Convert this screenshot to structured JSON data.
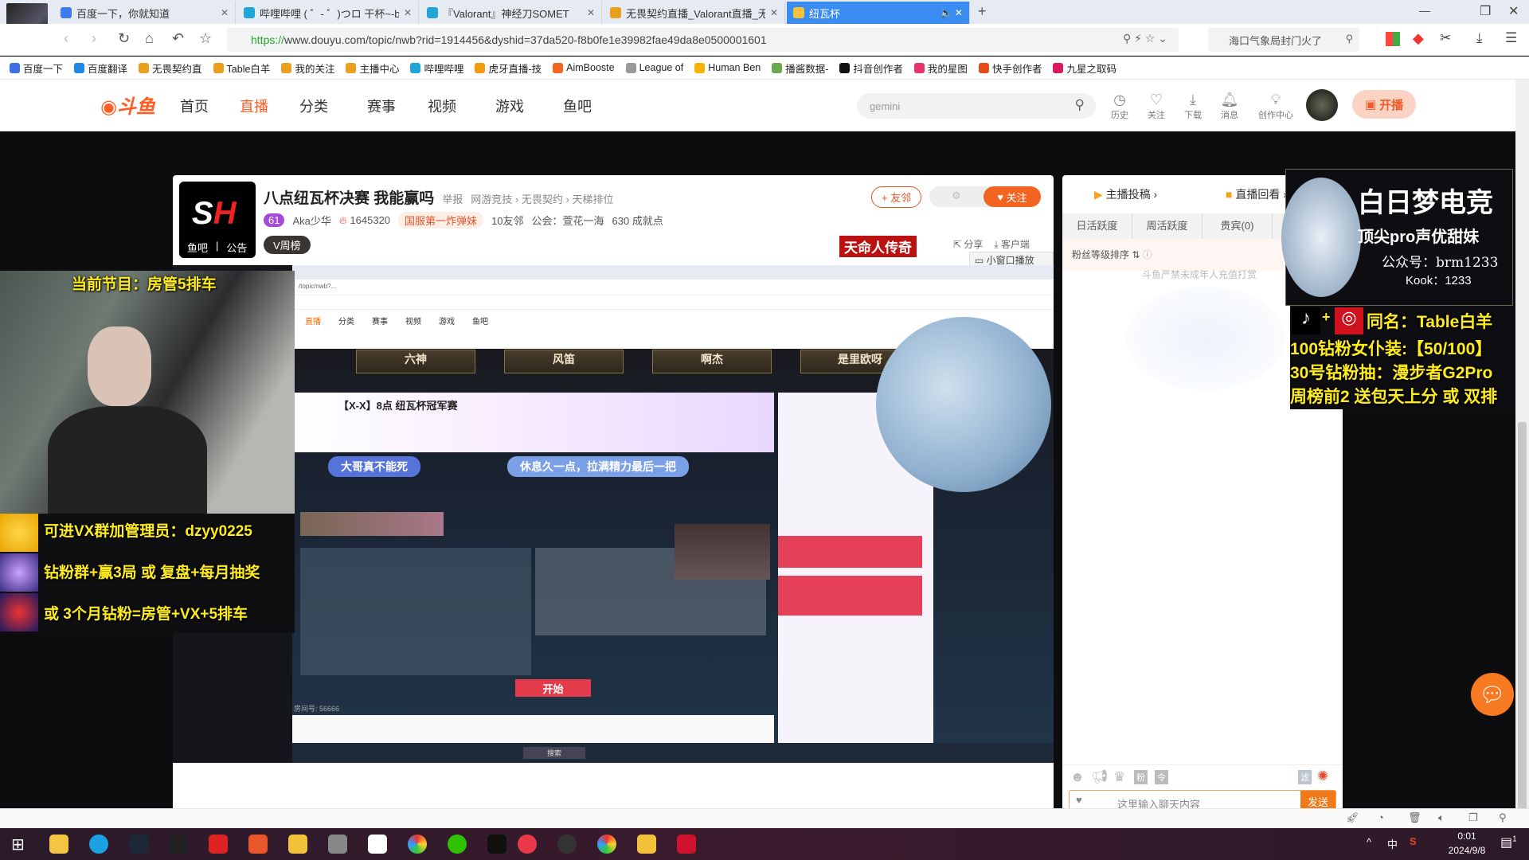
{
  "browser": {
    "tabs": [
      {
        "label": "百度一下，你就知道",
        "active": false
      },
      {
        "label": "哔哩哔哩 ( ゜- ゜)つロ 干杯~-bi",
        "active": false
      },
      {
        "label": "『Valorant』神经刀SOMET",
        "active": false
      },
      {
        "label": "无畏契约直播_Valorant直播_无",
        "active": false
      },
      {
        "label": "纽瓦杯",
        "active": true
      }
    ],
    "url_scheme": "https://",
    "url_rest": "www.douyu.com/topic/nwb?rid=1914456&dyshid=37da520-f8b0fe1e39982fae49da8e0500001601",
    "news_search": "海口气象局封门火了",
    "bookmarks": [
      "百度一下",
      "百度翻译",
      "无畏契约直",
      "Table白羊",
      "我的关注",
      "主播中心",
      "哔哩哔哩",
      "虎牙直播-技",
      "AimBooste",
      "League of",
      "Human Ben",
      "播酱数据-",
      "抖音创作者",
      "我的星图",
      "快手创作者",
      "九星之取码"
    ],
    "bookmark_colors": [
      "#3d6fe0",
      "#1e88e5",
      "#e9a01c",
      "#e9a01c",
      "#e9a01c",
      "#e9a01c",
      "#20a7d8",
      "#f39c12",
      "#f26522",
      "#999999",
      "#f4b400",
      "#6aa84f",
      "#111111",
      "#e8336b",
      "#e64a19",
      "#d81b60"
    ]
  },
  "douyu": {
    "nav": [
      "首页",
      "直播",
      "分类",
      "赛事",
      "视频",
      "游戏",
      "鱼吧"
    ],
    "active_nav": "直播",
    "search_value": "gemini",
    "header_icons": [
      {
        "icon": "history-icon",
        "label": "历史"
      },
      {
        "icon": "heart-icon",
        "label": "关注"
      },
      {
        "icon": "download-icon",
        "label": "下载"
      },
      {
        "icon": "bell-icon",
        "label": "消息"
      },
      {
        "icon": "bulb-icon",
        "label": "创作中心"
      }
    ],
    "start_live": "开播",
    "accent": "#ff5d23"
  },
  "room": {
    "title": "八点纽瓦杯决赛 我能赢吗",
    "report": "举报",
    "category": "网游竞技 › 无畏契约 › 天梯排位",
    "level": "61",
    "streamer": "Aka少华",
    "heat": "1645320",
    "honor": "国服第一炸弹妹",
    "friends": "10友邻",
    "guild": "公会：萱花一海",
    "achievement": "630 成就点",
    "weekly_rank": "V周榜",
    "logo_links": [
      "鱼吧",
      "公告"
    ],
    "add_friend": "+ 友邻",
    "follow": "关注",
    "promo": "天命人传奇",
    "share": "分享",
    "client": "客户端",
    "mini_player": "小窗口播放"
  },
  "stream": {
    "program": "当前节目：房管5排车",
    "lines": [
      "可进VX群加管理员：dzyy0225",
      "钻粉群+赢3局 或 复盘+每月抽奖",
      "或 3个月钻粉=房管+VX+5排车"
    ],
    "right_overlay": {
      "title": "白日梦电竞",
      "subtitle": "顶尖pro声优甜妹",
      "wechat": "公众号：brm1233",
      "kook": "Kook：1233"
    },
    "promo_lines": [
      "同名：Table白羊",
      "100钻粉女仆装:【50/100】",
      "30号钻粉抽：漫步者G2Pro",
      "周榜前2 送包天上分 或 双排"
    ],
    "inner": {
      "teams": [
        "六神",
        "风笛",
        "啊杰",
        "是里欧呀"
      ],
      "inner_title": "【X-X】8点 纽瓦杯冠军赛",
      "banner1": "大哥真不能死",
      "banner2": "休息久一点，拉满精力最后一把",
      "start": "开始",
      "room_no": "房间号: 56666",
      "search": "搜索"
    }
  },
  "side": {
    "tabs_top": [
      "主播投稿 ›",
      "直播回看 ›"
    ],
    "tabs": [
      "日活跃度",
      "周活跃度",
      "贵宾(0)"
    ],
    "fan_sort": "粉丝等级排序 ⇅",
    "notice": "斗鱼严禁未成年人充值打赏",
    "chat_placeholder": "这里输入聊天内容",
    "send": "发送",
    "filter": "滤",
    "fans": "粉",
    "cmd": "令"
  },
  "taskbar": {
    "time": "0:01",
    "date": "2024/9/8",
    "ime": "中",
    "notifications": "1"
  }
}
